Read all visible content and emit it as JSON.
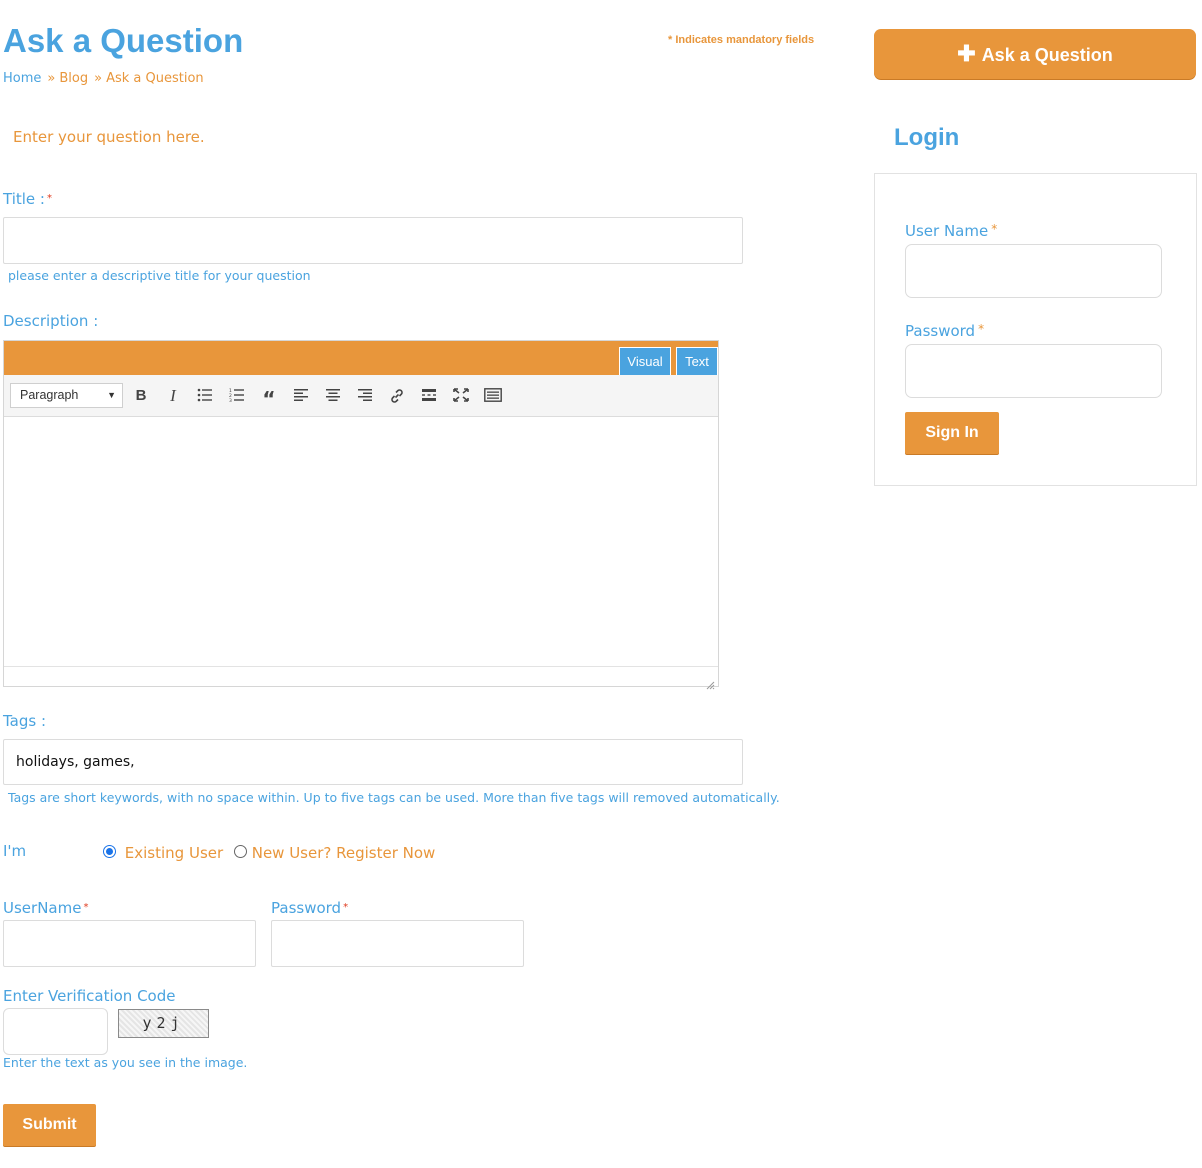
{
  "header": {
    "title": "Ask a Question",
    "mandatory_note": "* Indicates mandatory fields",
    "breadcrumb": [
      "Home",
      "Blog",
      "Ask a Question"
    ],
    "breadcrumb_sep": "»"
  },
  "form": {
    "intro": "Enter your question here.",
    "title_label": "Title :",
    "title_value": "",
    "title_hint": "please enter a descriptive title for your question",
    "description_label": "Description :",
    "editor": {
      "tabs": [
        "Visual",
        "Text"
      ],
      "format_select": "Paragraph",
      "tools": [
        "bold-icon",
        "italic-icon",
        "bulleted-list-icon",
        "numbered-list-icon",
        "blockquote-icon",
        "align-left-icon",
        "align-center-icon",
        "align-right-icon",
        "link-icon",
        "read-more-icon",
        "fullscreen-icon",
        "toolbar-toggle-icon"
      ]
    },
    "tags_label": "Tags :",
    "tags_value": "holidays, games,",
    "tags_hint": "Tags are short keywords, with no space within. Up to five tags can be used. More than five tags will removed automatically.",
    "im_label": "I'm",
    "user_options": [
      {
        "label": "Existing User",
        "selected": true
      },
      {
        "label": "New User? Register Now",
        "selected": false
      }
    ],
    "username_label": "UserName",
    "password_label": "Password",
    "verification_label": "Enter Verification Code",
    "captcha_text": "y2j",
    "verification_hint": "Enter the text as you see in the image.",
    "submit_label": "Submit",
    "required_mark": "*"
  },
  "sidebar": {
    "ask_button": "Ask a Question",
    "login_title": "Login",
    "username_label": "User Name",
    "password_label": "Password",
    "signin_label": "Sign In",
    "required_mark": "*"
  },
  "colors": {
    "accent_blue": "#4aa3df",
    "accent_orange": "#e8963b",
    "required_red": "#e03a1e"
  }
}
